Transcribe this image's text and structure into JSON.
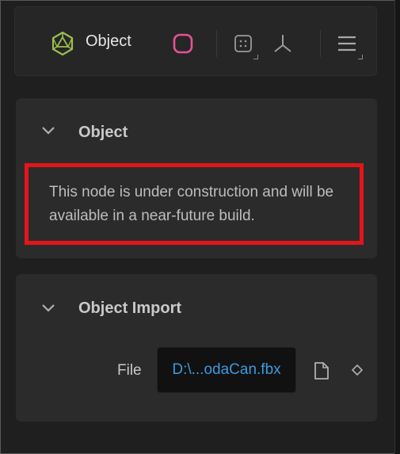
{
  "toolbar": {
    "title": "Object",
    "icons": [
      "object-cube-icon",
      "pink-rounded-square-icon",
      "grid-snap-icon",
      "axes-icon",
      "menu-icon"
    ]
  },
  "object_panel": {
    "title": "Object",
    "notice": "This node is under construction and will be available in a near-future build."
  },
  "import_panel": {
    "title": "Object Import",
    "file_label": "File",
    "file_value": "D:\\...odaCan.fbx"
  },
  "colors": {
    "accent_green": "#9bbf4f",
    "accent_pink": "#e8509a",
    "link_blue": "#3b9ae1",
    "highlight_red": "#e3151a"
  }
}
